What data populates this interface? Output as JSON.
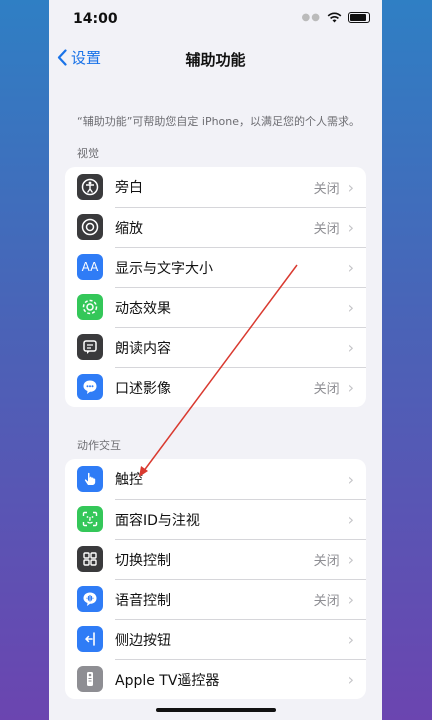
{
  "status": {
    "time": "14:00"
  },
  "nav": {
    "back_label": "设置",
    "title": "辅助功能"
  },
  "description": "“辅助功能”可帮助您自定 iPhone，以满足您的个人需求。",
  "sections": [
    {
      "title": "视觉",
      "rows": [
        {
          "label": "旁白",
          "value": "关闭",
          "icon": "voiceover-icon",
          "color": "#3a3a3c"
        },
        {
          "label": "缩放",
          "value": "关闭",
          "icon": "zoom-icon",
          "color": "#3a3a3c"
        },
        {
          "label": "显示与文字大小",
          "value": "",
          "icon": "text-size-icon",
          "color": "#2f7cf6"
        },
        {
          "label": "动态效果",
          "value": "",
          "icon": "motion-icon",
          "color": "#34c759"
        },
        {
          "label": "朗读内容",
          "value": "",
          "icon": "spoken-content-icon",
          "color": "#3a3a3c"
        },
        {
          "label": "口述影像",
          "value": "关闭",
          "icon": "audio-description-icon",
          "color": "#2f7cf6"
        }
      ]
    },
    {
      "title": "动作交互",
      "rows": [
        {
          "label": "触控",
          "value": "",
          "icon": "touch-icon",
          "color": "#2f7cf6"
        },
        {
          "label": "面容ID与注视",
          "value": "",
          "icon": "face-id-icon",
          "color": "#34c759"
        },
        {
          "label": "切换控制",
          "value": "关闭",
          "icon": "switch-control-icon",
          "color": "#3a3a3c"
        },
        {
          "label": "语音控制",
          "value": "关闭",
          "icon": "voice-control-icon",
          "color": "#2f7cf6"
        },
        {
          "label": "侧边按钮",
          "value": "",
          "icon": "side-button-icon",
          "color": "#2f7cf6"
        },
        {
          "label": "Apple TV遥控器",
          "value": "",
          "icon": "apple-tv-remote-icon",
          "color": "#8e8e93"
        }
      ]
    }
  ],
  "annotation_color": "#d93a30"
}
